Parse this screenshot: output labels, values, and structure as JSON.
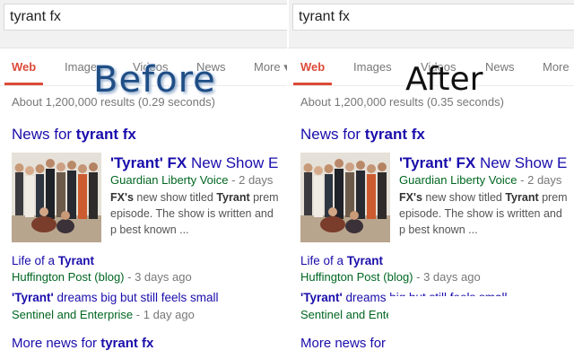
{
  "left": {
    "query": "tyrant fx",
    "tabs": [
      "Web",
      "Images",
      "Videos",
      "News",
      "More ▾"
    ],
    "stats": "About 1,200,000 results (0.29 seconds)",
    "news_heading_prefix": "News for ",
    "news_heading_query": "tyrant fx",
    "story": {
      "title_q1": "'Tyrant'",
      "title_fx": "FX",
      "title_rest": "New Show E",
      "source": "Guardian Liberty Voice",
      "age": "- 2 days",
      "snippet_lead": "FX's",
      "snippet_mid": "new show titled",
      "snippet_tyrant": "Tyrant",
      "snippet_rest": "prem episode. The show is written and p best known ..."
    },
    "link1": {
      "title_prefix": "Life of a ",
      "title_bold": "Tyrant",
      "source": "Huffington Post (blog)",
      "age": "- 3 days ago"
    },
    "link2": {
      "title_bold": "'Tyrant'",
      "title_rest": "dreams big but still feels small",
      "source": "Sentinel and Enterprise",
      "age": "- 1 day ago"
    },
    "more_news_prefix": "More news for ",
    "more_news_query": "tyrant fx",
    "overlay": "Before"
  },
  "right": {
    "query": "tyrant fx",
    "tabs": [
      "Web",
      "Images",
      "Videos",
      "News",
      "More"
    ],
    "stats": "About 1,200,000 results (0.35 seconds)",
    "news_heading_prefix": "News for ",
    "news_heading_query": "tyrant fx",
    "story": {
      "title_q1": "'Tyrant'",
      "title_fx": "FX",
      "title_rest": "New Show E",
      "source": "Guardian Liberty Voice",
      "age": "- 2 days",
      "snippet_lead": "FX's",
      "snippet_mid": "new show titled",
      "snippet_tyrant": "Tyrant",
      "snippet_rest": "prem episode. The show is written and p best known ..."
    },
    "link1": {
      "title_prefix": "Life of a ",
      "title_bold": "Tyrant",
      "source": "Huffington Post (blog)",
      "age": "- 3 days ago"
    },
    "link2": {
      "title_bold": "'Tyrant'",
      "title_rest": "dreams big but still feels small",
      "source": "Sentinel and Enterprise",
      "age": ""
    },
    "more_news_prefix": "More news for",
    "more_news_query": "",
    "overlay": "After"
  },
  "colors": {
    "link_blue": "#1a0dab",
    "source_green": "#006621",
    "active_tab_red": "#dd4b39",
    "meta_gray": "#777777"
  },
  "icons": {
    "thumbnail": "cast-photo-thumbnail"
  }
}
